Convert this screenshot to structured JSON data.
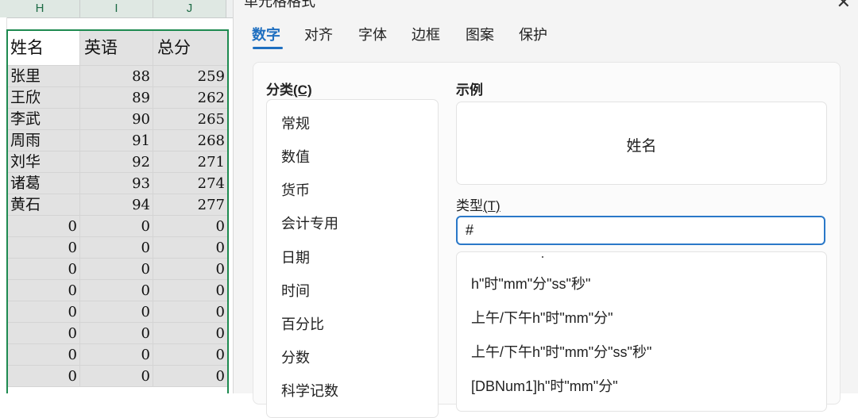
{
  "sheet": {
    "col_headers": [
      "H",
      "I",
      "J"
    ],
    "header_row": [
      "姓名",
      "英语",
      "总分"
    ],
    "rows": [
      {
        "name": "张里",
        "english": "88",
        "total": "259"
      },
      {
        "name": "王欣",
        "english": "89",
        "total": "262"
      },
      {
        "name": "李武",
        "english": "90",
        "total": "265"
      },
      {
        "name": "周雨",
        "english": "91",
        "total": "268"
      },
      {
        "name": "刘华",
        "english": "92",
        "total": "271"
      },
      {
        "name": "诸葛",
        "english": "93",
        "total": "274"
      },
      {
        "name": "黄石",
        "english": "94",
        "total": "277"
      },
      {
        "name": "0",
        "english": "0",
        "total": "0"
      },
      {
        "name": "0",
        "english": "0",
        "total": "0"
      },
      {
        "name": "0",
        "english": "0",
        "total": "0"
      },
      {
        "name": "0",
        "english": "0",
        "total": "0"
      },
      {
        "name": "0",
        "english": "0",
        "total": "0"
      },
      {
        "name": "0",
        "english": "0",
        "total": "0"
      },
      {
        "name": "0",
        "english": "0",
        "total": "0"
      },
      {
        "name": "0",
        "english": "0",
        "total": "0"
      }
    ],
    "selection_color": "#1e8a50"
  },
  "dialog": {
    "title": "单元格格式",
    "close_icon": "close-icon",
    "tabs": [
      "数字",
      "对齐",
      "字体",
      "边框",
      "图案",
      "保护"
    ],
    "active_tab": "数字",
    "category_label": "分类",
    "category_hotkey": "(C)",
    "categories": [
      "常规",
      "数值",
      "货币",
      "会计专用",
      "日期",
      "时间",
      "百分比",
      "分数",
      "科学记数"
    ],
    "sample_label": "示例",
    "sample_value": "姓名",
    "type_label": "类型",
    "type_hotkey": "(T)",
    "type_value": "#",
    "type_options": [
      "h\"时\"mm\"分\"ss\"秒\"",
      "上午/下午h\"时\"mm\"分\"",
      "上午/下午h\"时\"mm\"分\"ss\"秒\"",
      "[DBNum1]h\"时\"mm\"分\""
    ],
    "accent_color": "#1f6fc0"
  }
}
